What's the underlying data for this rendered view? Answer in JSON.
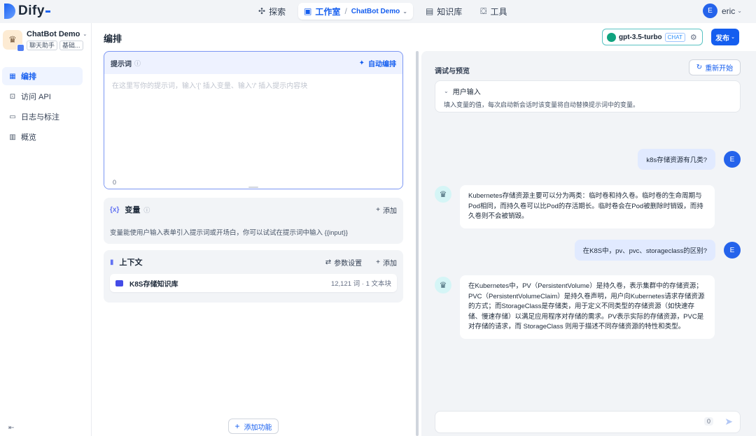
{
  "brand": {
    "name": "Dify"
  },
  "nav": {
    "explore": "探索",
    "studio": "工作室",
    "app": "ChatBot Demo",
    "knowledge": "知识库",
    "tools": "工具"
  },
  "user": {
    "initial": "E",
    "name": "eric"
  },
  "app": {
    "name": "ChatBot Demo",
    "tags": [
      "聊天助手",
      "基础..."
    ]
  },
  "sidebar": {
    "items": [
      {
        "label": "编排",
        "icon": "orchestrate-icon"
      },
      {
        "label": "访问 API",
        "icon": "terminal-icon"
      },
      {
        "label": "日志与标注",
        "icon": "log-icon"
      },
      {
        "label": "概览",
        "icon": "chart-icon"
      }
    ]
  },
  "page": {
    "title": "编排"
  },
  "model": {
    "name": "gpt-3.5-turbo",
    "mode": "CHAT"
  },
  "publish": {
    "label": "发布"
  },
  "prompt": {
    "title": "提示词",
    "auto_label": "自动编排",
    "placeholder": "在这里写你的提示词，输入'{' 插入变量、输入'/' 插入提示内容块",
    "count": "0"
  },
  "variables": {
    "title": "变量",
    "add": "添加",
    "desc": "变量能使用户输入表单引入提示词或开场白，你可以试试在提示词中输入 {{input}}"
  },
  "context": {
    "title": "上下文",
    "params": "参数设置",
    "add": "添加",
    "kb_name": "K8S存储知识库",
    "kb_info": "12,121 词 · 1 文本块"
  },
  "add_feature": "添加功能",
  "debug": {
    "title": "调试与预览",
    "restart": "重新开始",
    "user_input_title": "用户输入",
    "user_input_desc": "填入变量的值，每次启动新会话时该变量将自动替换提示词中的变量。",
    "input_count": "0"
  },
  "chat": {
    "q1": "k8s存储资源有几类?",
    "a1": "Kubernetes存储资源主要可以分为两类：临时卷和持久卷。临时卷的生命周期与Pod相同，而持久卷可以比Pod的存活期长。临时卷会在Pod被删除时销毁，而持久卷则不会被销毁。",
    "q2": "在K8S中，pv、pvc、storageclass的区别?",
    "a2": "在Kubernetes中，PV（PersistentVolume）是持久卷，表示集群中的存储资源；PVC（PersistentVolumeClaim）是持久卷声明，用户向Kubernetes请求存储资源的方式；而StorageClass是存储类，用于定义不同类型的存储资源（如快速存储、慢速存储）以满足应用程序对存储的需求。PV表示实际的存储资源，PVC是对存储的请求，而 StorageClass 则用于描述不同存储资源的特性和类型。"
  },
  "colors": {
    "accent": "#155eef",
    "model_border": "#59c3c3"
  }
}
